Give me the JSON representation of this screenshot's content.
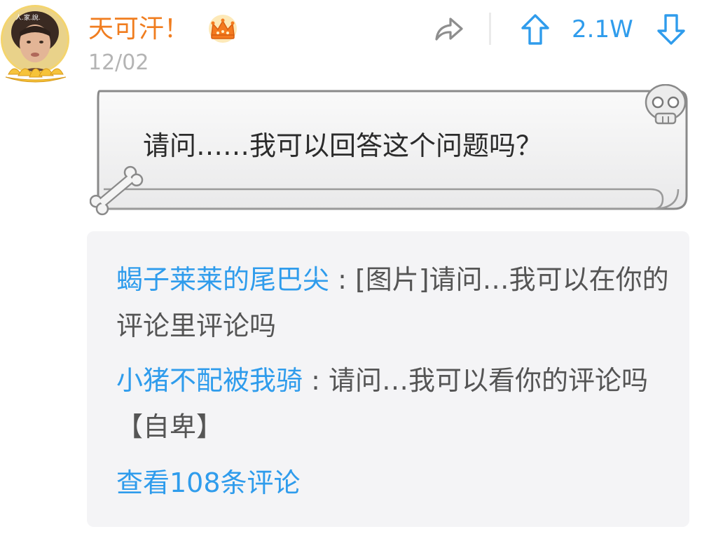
{
  "post": {
    "username": "天可汗！",
    "date": "12/02",
    "vote_count": "2.1W",
    "content": "请问……我可以回答这个问题吗？"
  },
  "icons": {
    "avatar": "avatar",
    "crown": "crown-badge-icon",
    "share": "share-arrow-icon",
    "upvote": "arrow-up-icon",
    "downvote": "arrow-down-icon",
    "skull": "skull-icon",
    "bone": "bone-icon"
  },
  "comments": [
    {
      "author": "蝎子莱莱的尾巴尖",
      "separator": " : ",
      "text": "[图片]请问…我可以在你的评论里评论吗"
    },
    {
      "author": "小猪不配被我骑",
      "separator": " : ",
      "text": "请问…我可以看你的评论吗【自卑】"
    }
  ],
  "view_more_label": "查看108条评论",
  "colors": {
    "username": "#f07d1f",
    "accent_blue": "#2f9cec",
    "date_gray": "#b4b4b4",
    "comment_bg": "#f4f4f6",
    "comment_text": "#555555"
  }
}
